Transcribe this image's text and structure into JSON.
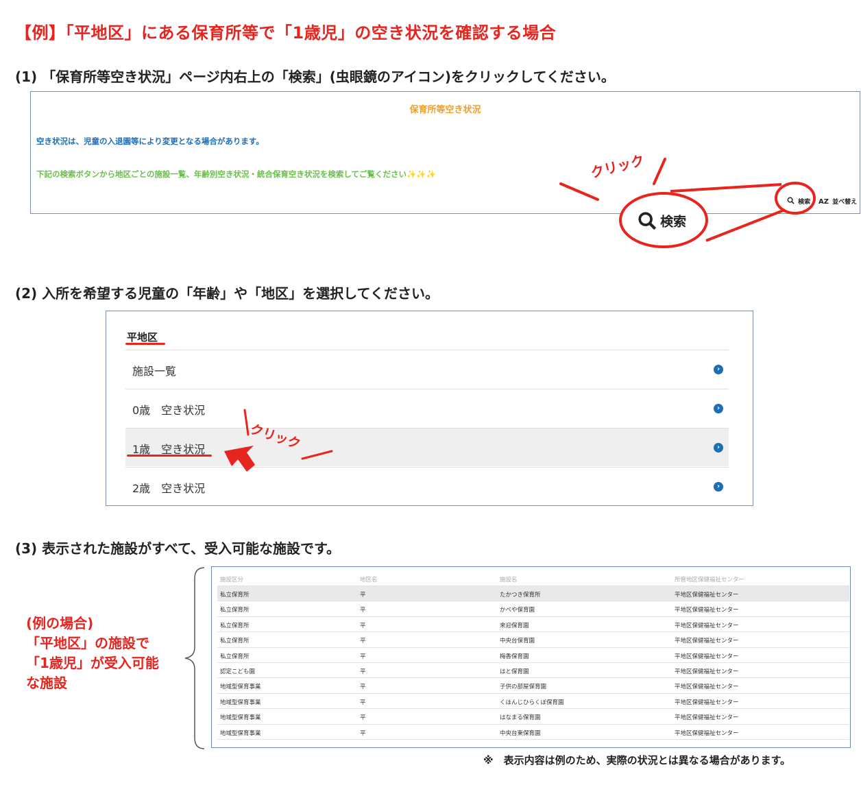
{
  "title": "【例】「平地区」にある保育所等で「1歳児」の空き状況を確認する場合",
  "steps": {
    "s1": "(1) 「保育所等空き状況」ページ内右上の「検索」(虫眼鏡のアイコン)をクリックしてください。",
    "s2": "(2) 入所を希望する児童の「年齢」や「地区」を選択してください。",
    "s3": "(3) 表示された施設がすべて、受入可能な施設です。"
  },
  "box1": {
    "page_title": "保育所等空き状況",
    "line1": "空き状況は、児童の入退園等により変更となる場合があります。",
    "line2": "下記の検索ボタンから地区ごとの施設一覧、年齢別空き状況・統合保育空き状況を検索してご覧ください✨✨✨",
    "search_label": "検索",
    "sort_label": "並べ替え",
    "sort_icon": "AZ",
    "click_label": "クリック",
    "zoom_label": "検索"
  },
  "box2": {
    "heading": "平地区",
    "items": [
      {
        "label": "施設一覧"
      },
      {
        "label": "0歳　空き状況"
      },
      {
        "label": "1歳　空き状況"
      },
      {
        "label": "2歳　空き状況"
      }
    ],
    "click_label": "クリック"
  },
  "table": {
    "headers": [
      "施設区分",
      "地区名",
      "施設名",
      "所管地区保健福祉センター"
    ],
    "rows": [
      [
        "私立保育所",
        "平",
        "たかつき保育所",
        "平地区保健福祉センター"
      ],
      [
        "私立保育所",
        "平",
        "かべや保育園",
        "平地区保健福祉センター"
      ],
      [
        "私立保育所",
        "平",
        "来迎保育園",
        "平地区保健福祉センター"
      ],
      [
        "私立保育所",
        "平",
        "中央台保育園",
        "平地区保健福祉センター"
      ],
      [
        "私立保育所",
        "平",
        "梅香保育園",
        "平地区保健福祉センター"
      ],
      [
        "認定こども園",
        "平",
        "はと保育園",
        "平地区保健福祉センター"
      ],
      [
        "地域型保育事業",
        "平",
        "子供の部屋保育園",
        "平地区保健福祉センター"
      ],
      [
        "地域型保育事業",
        "平",
        "くほんじひらくぼ保育園",
        "平地区保健福祉センター"
      ],
      [
        "地域型保育事業",
        "平",
        "はなまる保育園",
        "平地区保健福祉センター"
      ],
      [
        "地域型保育事業",
        "平",
        "中央台東保育園",
        "平地区保健福祉センター"
      ]
    ]
  },
  "side_note": [
    "(例の場合)",
    "「平地区」の施設で",
    "「1歳児」が受入可能",
    "な施設"
  ],
  "footnote": "※　表示内容は例のため、実際の状況とは異なる場合があります。",
  "colors": {
    "accent_red": "#e8241f",
    "link_blue": "#1d6eb5",
    "orange": "#f0a028",
    "green": "#6abf4b"
  }
}
